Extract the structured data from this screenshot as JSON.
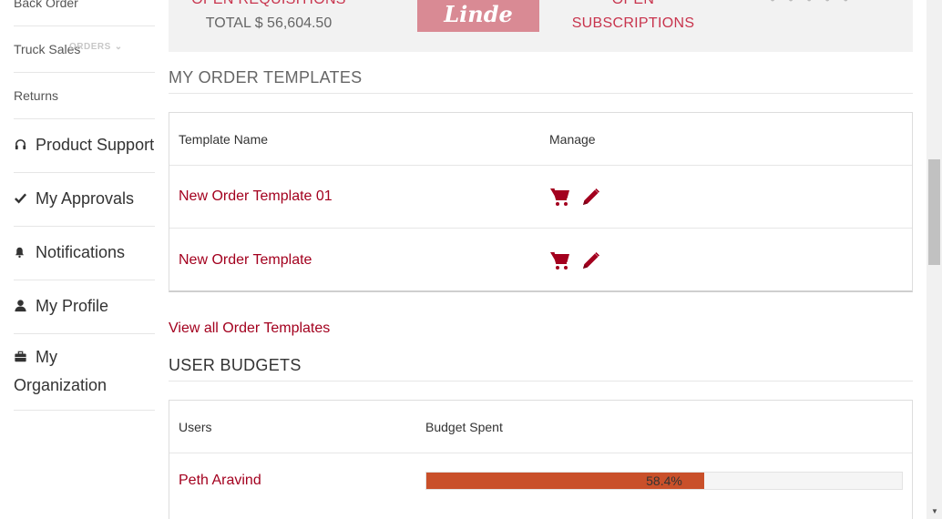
{
  "sidebar": {
    "orders_toggle": "ORDERS",
    "items": [
      {
        "label": "Back Order",
        "icon": ""
      },
      {
        "label": "Truck Sales",
        "icon": ""
      },
      {
        "label": "Returns",
        "icon": ""
      },
      {
        "label": "Product Support",
        "icon": "headset-icon"
      },
      {
        "label": "My Approvals",
        "icon": "check-icon"
      },
      {
        "label": "Notifications",
        "icon": "bell-icon"
      },
      {
        "label": "My Profile",
        "icon": "user-icon"
      },
      {
        "label": "My",
        "label2": "Organization",
        "icon": "briefcase-icon"
      }
    ]
  },
  "summary": {
    "requisitions_label": "OPEN REQUISITIONS",
    "requisitions_total": "TOTAL $ 56,604.50",
    "logo_text": "Linde",
    "subscriptions_line1": "OPEN",
    "subscriptions_line2": "SUBSCRIPTIONS"
  },
  "templates": {
    "title": "MY ORDER TEMPLATES",
    "col_name": "Template Name",
    "col_manage": "Manage",
    "rows": [
      {
        "name": "New Order Template 01"
      },
      {
        "name": "New Order Template"
      }
    ],
    "view_all": "View all Order Templates"
  },
  "budgets": {
    "title": "USER BUDGETS",
    "col_users": "Users",
    "col_spent": "Budget Spent",
    "rows": [
      {
        "user": "Peth Aravind",
        "spent_label": "58.4%",
        "spent_fraction": 0.584
      }
    ]
  },
  "colors": {
    "brand_red": "#a3001e",
    "progress_fill": "#c9502a",
    "summary_bg": "#f2f2f2"
  }
}
